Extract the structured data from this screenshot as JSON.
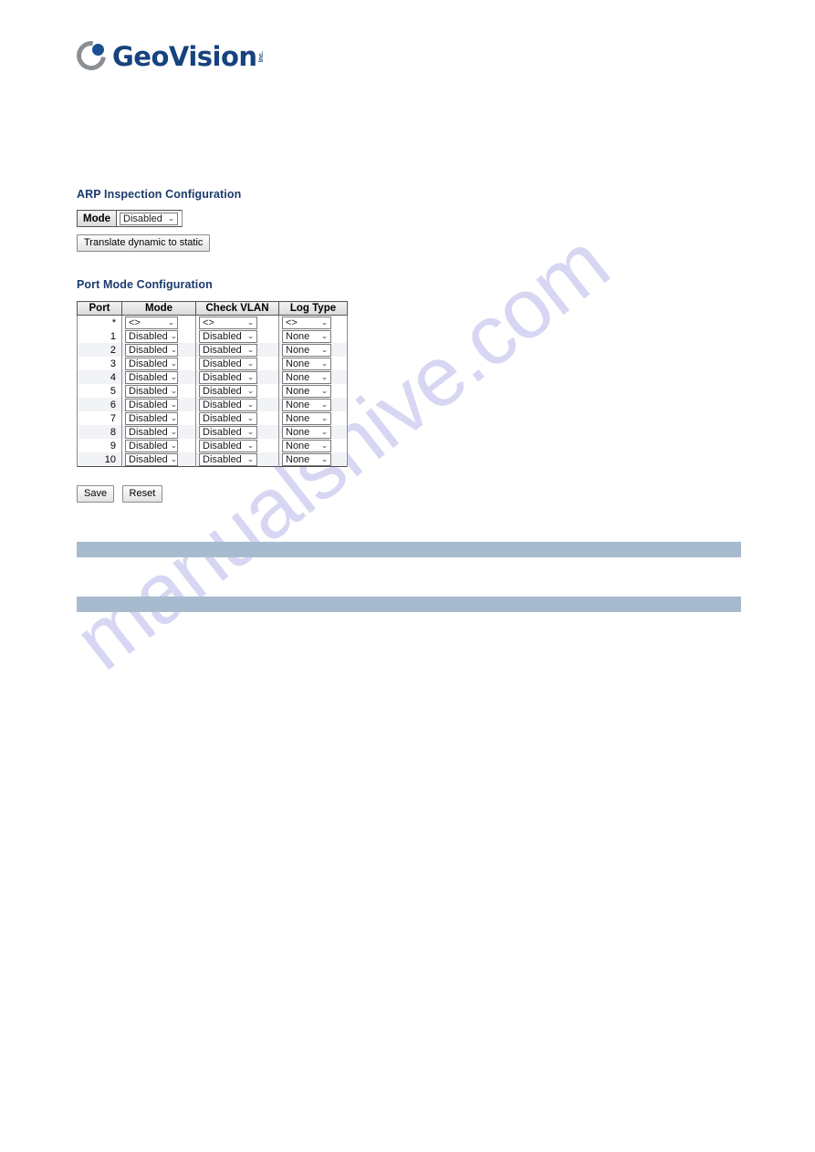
{
  "brand": {
    "name": "GeoVision",
    "suffix": "Inc.",
    "logo_mark": "c-arc-with-dot",
    "text_color": "#16427e"
  },
  "arp_section": {
    "title": "ARP Inspection Configuration",
    "mode_label": "Mode",
    "mode_value": "Disabled",
    "translate_button": "Translate dynamic to static"
  },
  "port_section": {
    "title": "Port Mode Configuration",
    "columns": [
      "Port",
      "Mode",
      "Check VLAN",
      "Log Type"
    ],
    "wildcard_row": {
      "port": "*",
      "mode": "<>",
      "check_vlan": "<>",
      "log_type": "<>"
    },
    "rows": [
      {
        "port": "1",
        "mode": "Disabled",
        "check_vlan": "Disabled",
        "log_type": "None"
      },
      {
        "port": "2",
        "mode": "Disabled",
        "check_vlan": "Disabled",
        "log_type": "None"
      },
      {
        "port": "3",
        "mode": "Disabled",
        "check_vlan": "Disabled",
        "log_type": "None"
      },
      {
        "port": "4",
        "mode": "Disabled",
        "check_vlan": "Disabled",
        "log_type": "None"
      },
      {
        "port": "5",
        "mode": "Disabled",
        "check_vlan": "Disabled",
        "log_type": "None"
      },
      {
        "port": "6",
        "mode": "Disabled",
        "check_vlan": "Disabled",
        "log_type": "None"
      },
      {
        "port": "7",
        "mode": "Disabled",
        "check_vlan": "Disabled",
        "log_type": "None"
      },
      {
        "port": "8",
        "mode": "Disabled",
        "check_vlan": "Disabled",
        "log_type": "None"
      },
      {
        "port": "9",
        "mode": "Disabled",
        "check_vlan": "Disabled",
        "log_type": "None"
      },
      {
        "port": "10",
        "mode": "Disabled",
        "check_vlan": "Disabled",
        "log_type": "None"
      }
    ]
  },
  "actions": {
    "save_label": "Save",
    "reset_label": "Reset"
  },
  "bars": {
    "color": "#a8bace",
    "count": 2
  },
  "watermark": {
    "text": "manualshive.com",
    "color": "#c9c9ef"
  },
  "icons": {
    "chevron_down": "⌄"
  }
}
